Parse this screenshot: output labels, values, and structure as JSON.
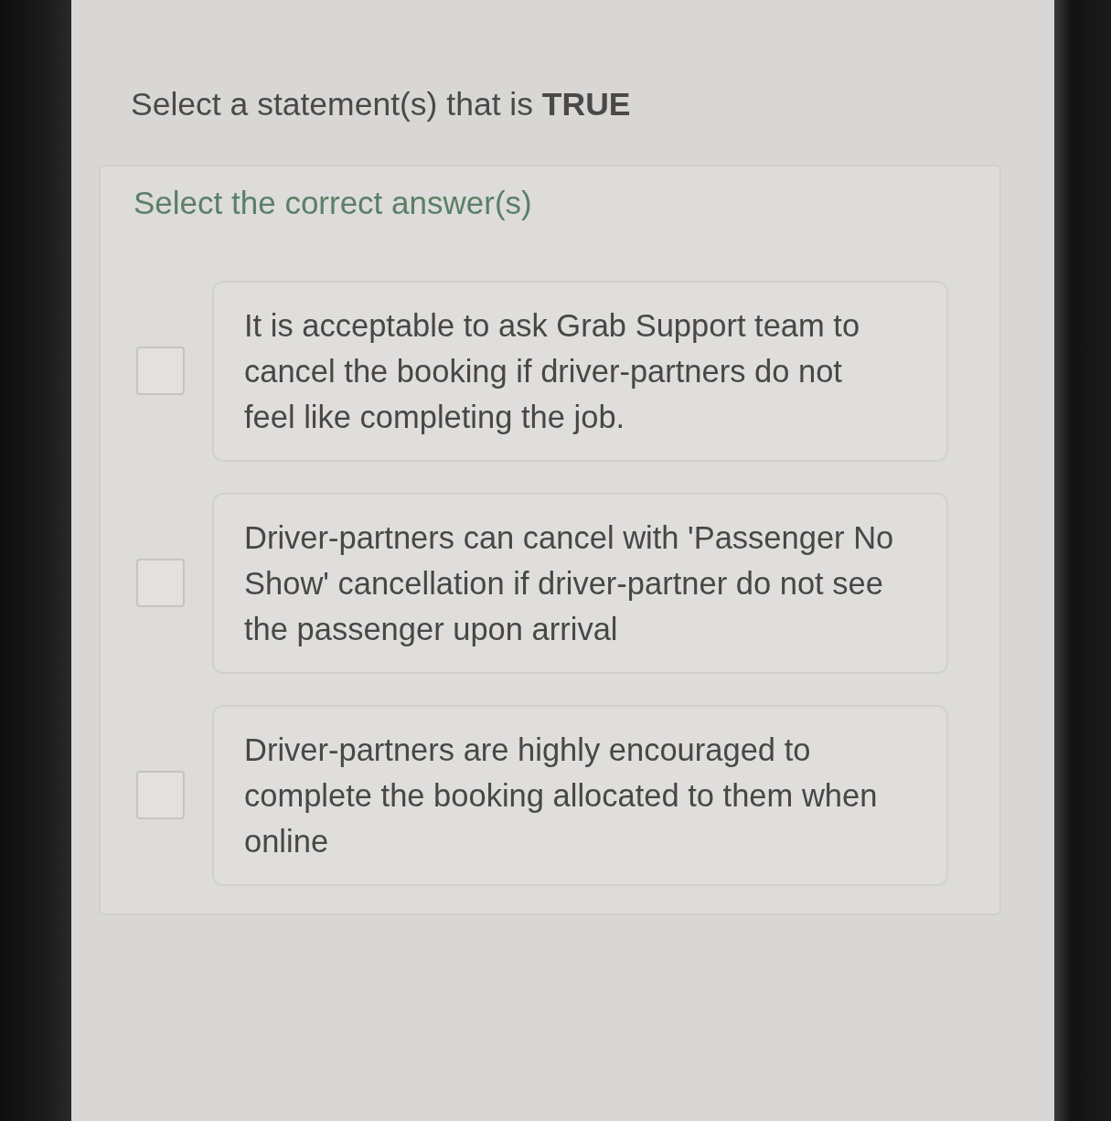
{
  "question": {
    "text": "Select a statement(s) that is **TRUE**"
  },
  "instruction": "Select the correct answer(s)",
  "options": [
    {
      "text": "It is acceptable to ask Grab Support team to cancel the booking if driver-partners do not feel like completing the job.",
      "checked": false
    },
    {
      "text": "Driver-partners can cancel with 'Passenger No Show' cancellation if driver-partner do not see the passenger upon arrival",
      "checked": false
    },
    {
      "text": "Driver-partners are highly encouraged to complete the booking allocated to them when online",
      "checked": false
    }
  ]
}
